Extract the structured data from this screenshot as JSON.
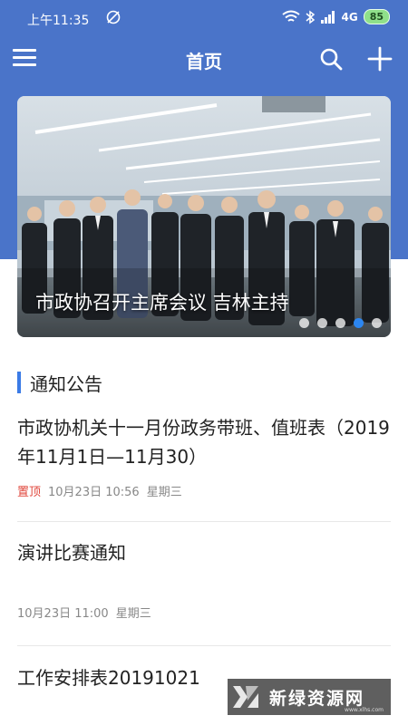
{
  "status_bar": {
    "time": "上午11:35",
    "network": "4G",
    "battery": "85"
  },
  "header": {
    "title": "首页"
  },
  "banner": {
    "caption": "市政协召开主席会议 吉林主持",
    "dot_count": 5,
    "active_dot": 4
  },
  "notice_section": {
    "title": "通知公告",
    "items": [
      {
        "title": "市政协机关十一月份政务带班、值班表（2019年11月1日—11月30）",
        "pinned_label": "置顶",
        "date": "10月23日 10:56",
        "weekday": "星期三"
      },
      {
        "title": "演讲比赛通知",
        "date": "10月23日 11:00",
        "weekday": "星期三"
      },
      {
        "title": "工作安排表20191021"
      }
    ]
  },
  "watermark": {
    "text": "新绿资源网",
    "sub": "www.xlhs.com"
  },
  "colors": {
    "header_blue": "#4a74c9",
    "accent_blue": "#3b7be6",
    "pinned_red": "#e0473c"
  }
}
